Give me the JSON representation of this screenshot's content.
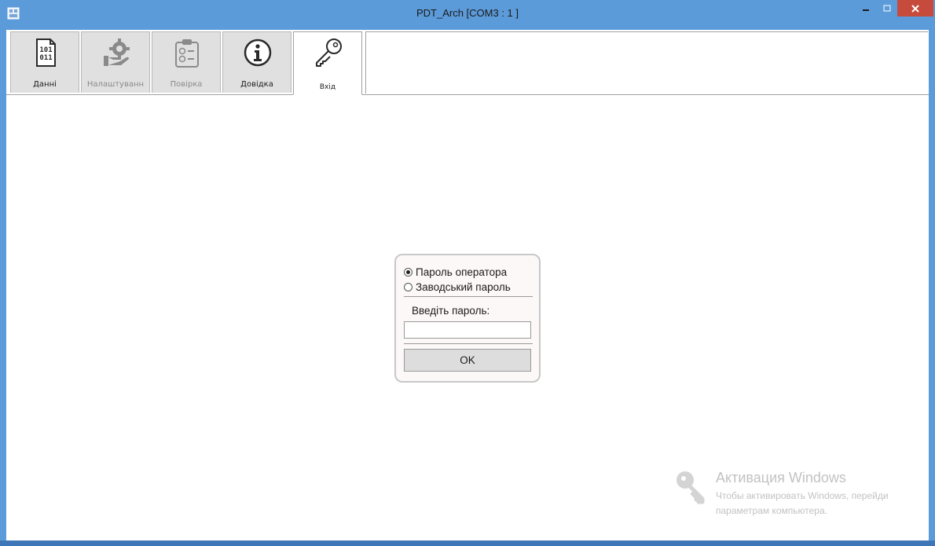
{
  "window": {
    "title": "PDT_Arch [COM3 : 1 ]",
    "controls": {
      "minimize": "–",
      "maximize": "□",
      "close": "✕"
    }
  },
  "ribbon": {
    "tabs": [
      {
        "label": "Данні",
        "icon": "binary-file-icon",
        "state": "normal"
      },
      {
        "label": "Налаштуванн",
        "icon": "gear-hand-icon",
        "state": "disabled"
      },
      {
        "label": "Повірка",
        "icon": "checklist-icon",
        "state": "disabled"
      },
      {
        "label": "Довідка",
        "icon": "info-icon",
        "state": "normal"
      },
      {
        "label": "Вхід",
        "icon": "key-icon",
        "state": "active"
      }
    ]
  },
  "login": {
    "options": [
      {
        "label": "Пароль оператора",
        "selected": true
      },
      {
        "label": "Заводський пароль",
        "selected": false
      }
    ],
    "password_label": "Введіть пароль:",
    "password_value": "",
    "ok_label": "OK"
  },
  "watermark": {
    "title": "Активация Windows",
    "line1": "Чтобы активировать Windows, перейди",
    "line2": "параметрам компьютера."
  },
  "colors": {
    "frame": "#5c9bd9",
    "close_button": "#c74b3c",
    "tab_bg": "#e0e0e0",
    "dialog_bg": "#fdf8f8"
  }
}
